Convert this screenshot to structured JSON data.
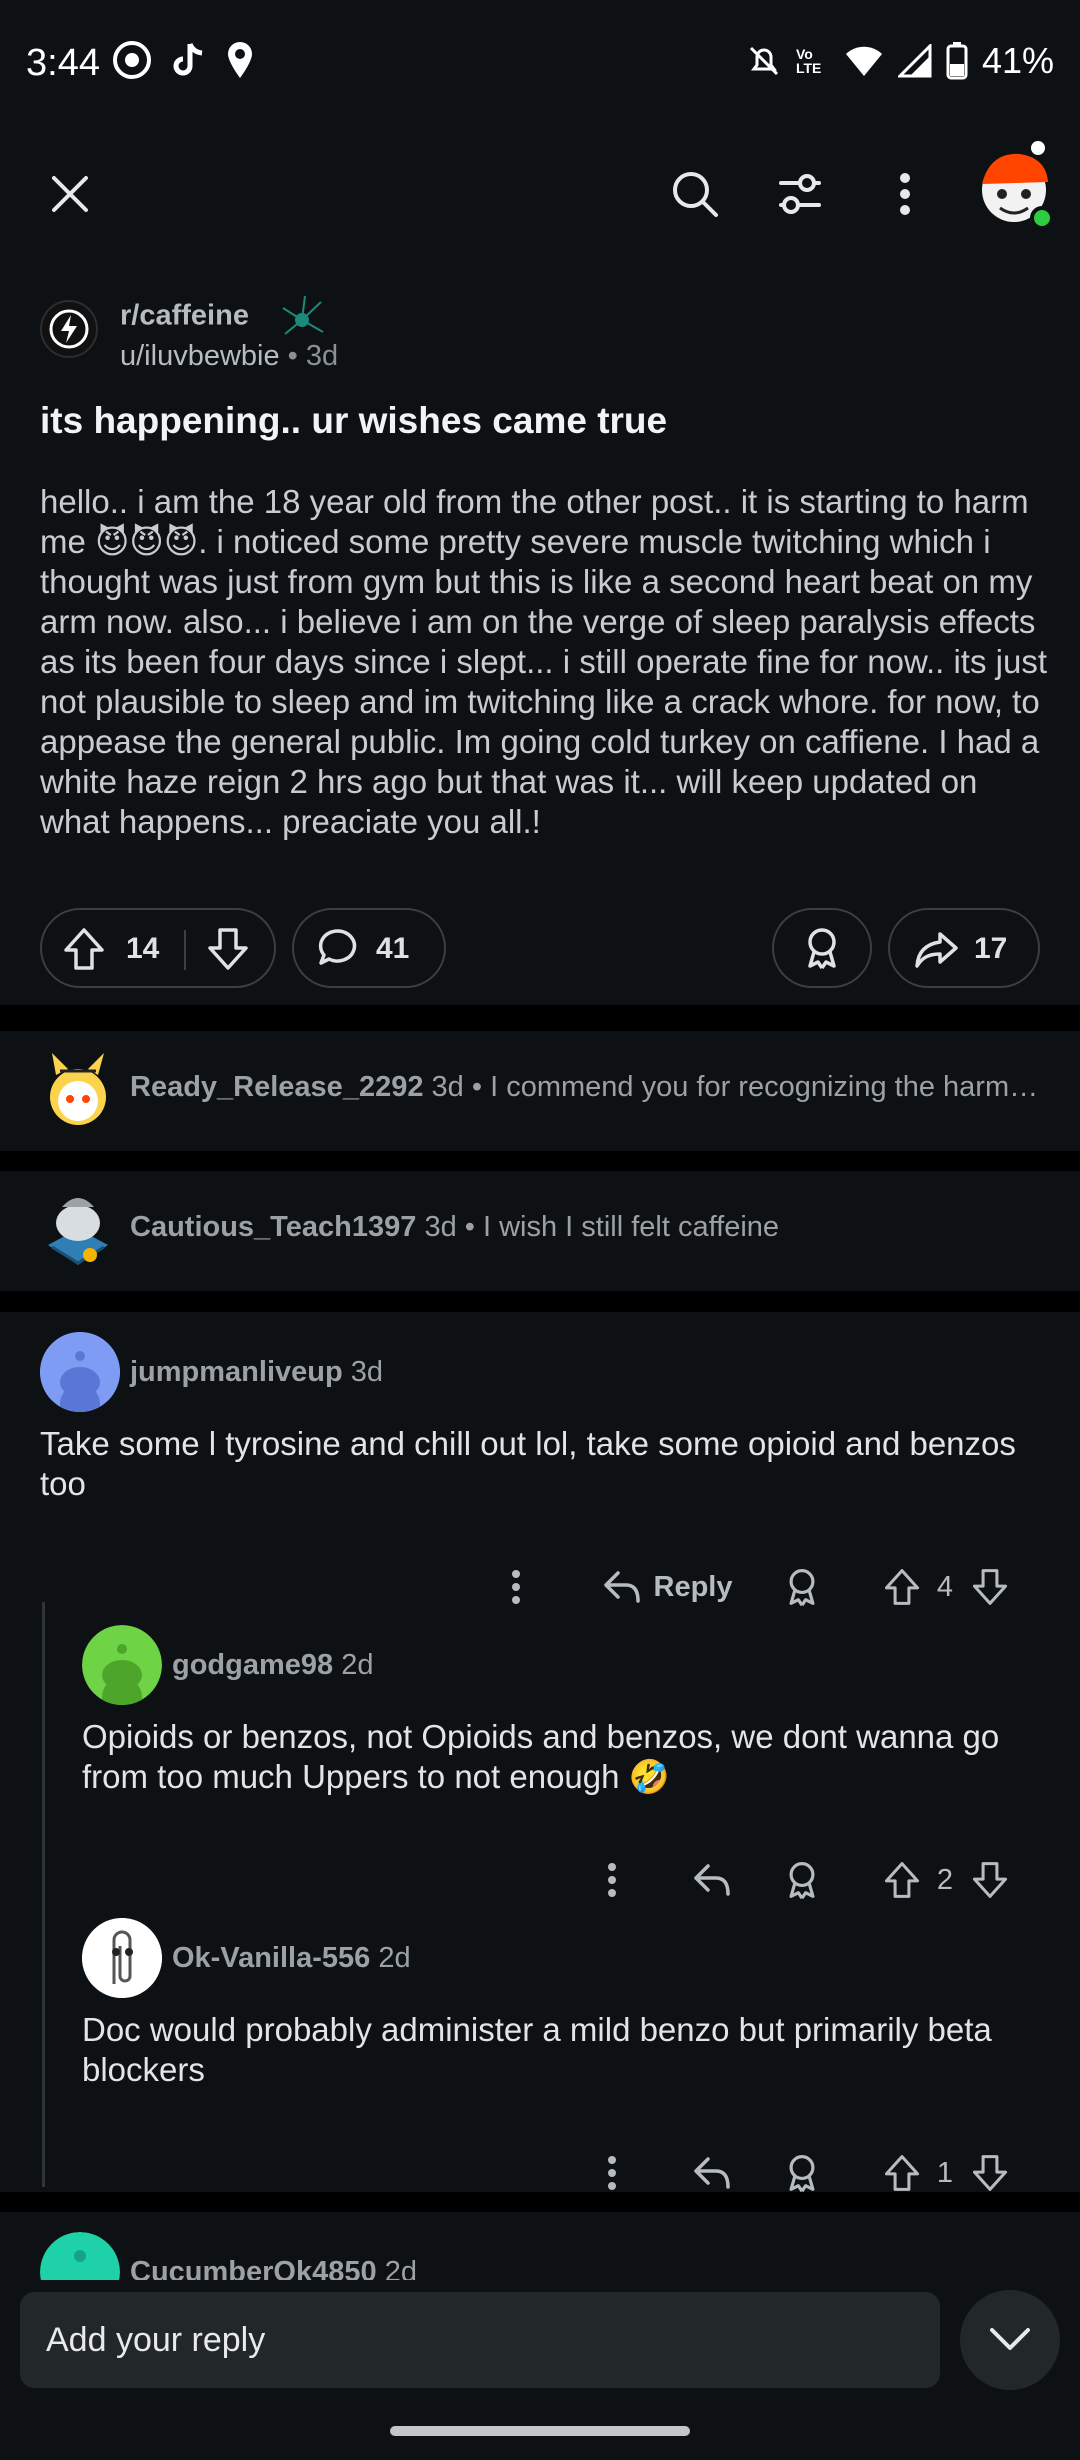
{
  "status_bar": {
    "time": "3:44",
    "battery": "41%",
    "network": "Vo LTE"
  },
  "post": {
    "subreddit": "r/caffeine",
    "author": "u/iluvbewbie",
    "age": "3d",
    "title": "its happening.. ur wishes came true",
    "body": "hello.. i am the 18 year old from the other post.. it is starting to harm me 😈😈😈. i noticed some pretty severe muscle twitching which i thought was just from gym but this is like a second heart beat on my arm now. also... i believe i am on the verge of sleep paralysis effects as its been four days since i slept... i still operate fine for now.. its just not plausible to sleep and im twitching like a crack whore. for now, to appease the general public. Im going cold turkey on caffiene. I had a white haze reign 2 hrs ago but that was it... will keep updated on what happens... preaciate you all.!",
    "upvotes": "14",
    "comments": "41",
    "shares": "17"
  },
  "collapsed_comments": [
    {
      "user": "Ready_Release_2292",
      "age": "3d",
      "preview": "I commend you for recognizing the harm…"
    },
    {
      "user": "Cautious_Teach1397",
      "age": "3d",
      "preview": "I wish I still felt caffeine"
    }
  ],
  "comments": [
    {
      "user": "jumpmanliveup",
      "age": "3d",
      "text": "Take some l tyrosine and chill out lol, take some opioid and benzos too",
      "reply_label": "Reply",
      "votes": "4"
    },
    {
      "user": "godgame98",
      "age": "2d",
      "text": "Opioids or benzos, not Opioids and benzos, we dont wanna go from too much Uppers to not enough 🤣",
      "votes": "2"
    },
    {
      "user": "Ok-Vanilla-556",
      "age": "2d",
      "text": "Doc would probably administer a mild benzo but primarily beta blockers",
      "votes": "1"
    }
  ],
  "partial_comment": {
    "user": "CucumberOk4850",
    "age": "2d"
  },
  "reply_bar": {
    "placeholder": "Add your reply"
  },
  "colors": {
    "background": "#0e1113",
    "separator": "#000000",
    "pill_border": "#3a3f43",
    "online": "#2ecc40"
  }
}
